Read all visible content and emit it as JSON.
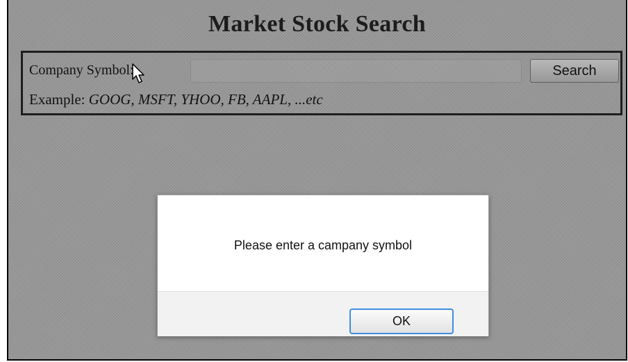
{
  "page": {
    "title": "Market Stock Search"
  },
  "search": {
    "label": "Company Symbol:",
    "input_value": "",
    "button_label": "Search",
    "example_prefix": "Example: ",
    "example_values": "GOOG, MSFT, YHOO, FB, AAPL, ...etc"
  },
  "dialog": {
    "message": "Please enter a campany symbol",
    "ok_label": "OK"
  },
  "icons": {
    "cursor": "mouse-pointer-icon"
  },
  "colors": {
    "overlay_gray": "#9c9c9c",
    "dialog_focus_blue": "#3d8ee0"
  }
}
